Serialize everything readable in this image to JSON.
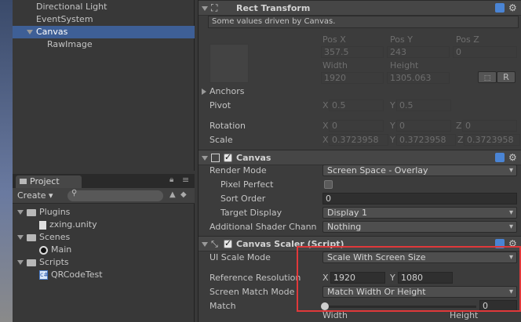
{
  "hierarchy": {
    "items": [
      {
        "label": "Directional Light"
      },
      {
        "label": "EventSystem"
      },
      {
        "label": "Canvas"
      },
      {
        "label": "RawImage"
      }
    ]
  },
  "project": {
    "tab_label": "Project",
    "create_label": "Create",
    "tree": [
      {
        "label": "Plugins",
        "type": "folder"
      },
      {
        "label": "zxing.unity",
        "type": "file"
      },
      {
        "label": "Scenes",
        "type": "folder"
      },
      {
        "label": "Main",
        "type": "scene"
      },
      {
        "label": "Scripts",
        "type": "folder"
      },
      {
        "label": "QRCodeTest",
        "type": "script"
      }
    ]
  },
  "rect_transform": {
    "title": "Rect Transform",
    "notice": "Some values driven by Canvas.",
    "pos_x_label": "Pos X",
    "pos_y_label": "Pos Y",
    "pos_z_label": "Pos Z",
    "pos_x": "357.5",
    "pos_y": "243",
    "pos_z": "0",
    "width_label": "Width",
    "height_label": "Height",
    "width": "1920",
    "height": "1305.063",
    "r_button": "R",
    "anchors_label": "Anchors",
    "pivot_label": "Pivot",
    "pivot_x": "0.5",
    "pivot_y": "0.5",
    "rotation_label": "Rotation",
    "rot_x": "0",
    "rot_y": "0",
    "rot_z": "0",
    "scale_label": "Scale",
    "scale_x": "0.3723958",
    "scale_y": "0.3723958",
    "scale_z": "0.3723958",
    "x_label": "X",
    "y_label": "Y",
    "z_label": "Z"
  },
  "canvas": {
    "title": "Canvas",
    "render_mode_label": "Render Mode",
    "render_mode_value": "Screen Space - Overlay",
    "pixel_perfect_label": "Pixel Perfect",
    "sort_order_label": "Sort Order",
    "sort_order_value": "0",
    "target_display_label": "Target Display",
    "target_display_value": "Display 1",
    "shader_channels_label": "Additional Shader Chann",
    "shader_channels_value": "Nothing"
  },
  "canvas_scaler": {
    "title": "Canvas Scaler (Script)",
    "ui_scale_mode_label": "UI Scale Mode",
    "ui_scale_mode_value": "Scale With Screen Size",
    "ref_resolution_label": "Reference Resolution",
    "ref_x_label": "X",
    "ref_y_label": "Y",
    "ref_x": "1920",
    "ref_y": "1080",
    "screen_match_mode_label": "Screen Match Mode",
    "screen_match_mode_value": "Match Width Or Height",
    "match_label": "Match",
    "match_value": "0",
    "match_fraction": 0,
    "width_label": "Width",
    "height_label": "Height"
  },
  "colors": {
    "selection": "#3e5f96",
    "highlight_box": "#e0383a"
  }
}
